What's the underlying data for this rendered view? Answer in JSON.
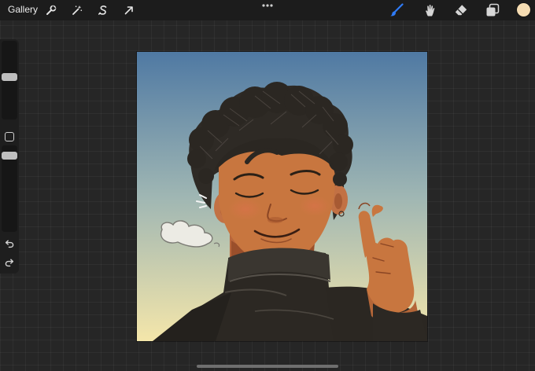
{
  "toolbar": {
    "gallery_label": "Gallery",
    "left_tools": [
      {
        "icon": "wrench-icon"
      },
      {
        "icon": "magic-wand-icon"
      },
      {
        "icon": "selection-s-icon"
      },
      {
        "icon": "transform-arrow-icon"
      }
    ],
    "menu_icon": "more-dots-icon",
    "right_tools": [
      {
        "icon": "brush-icon",
        "active": true
      },
      {
        "icon": "smudge-icon",
        "active": false
      },
      {
        "icon": "eraser-icon",
        "active": false
      },
      {
        "icon": "layers-icon",
        "active": false
      }
    ],
    "current_color": "#f5dcb2",
    "active_tool_color": "#2f7bf6"
  },
  "sidebar": {
    "brush_size_level": 0.45,
    "brush_opacity_level": 0.08,
    "undo_icon": "undo-icon",
    "redo_icon": "redo-icon",
    "modify_icon": "square-icon"
  },
  "canvas": {
    "artwork": "digital-portrait",
    "sky_top_color": "#4f79a3",
    "sky_bottom_color": "#f4e6aa"
  }
}
